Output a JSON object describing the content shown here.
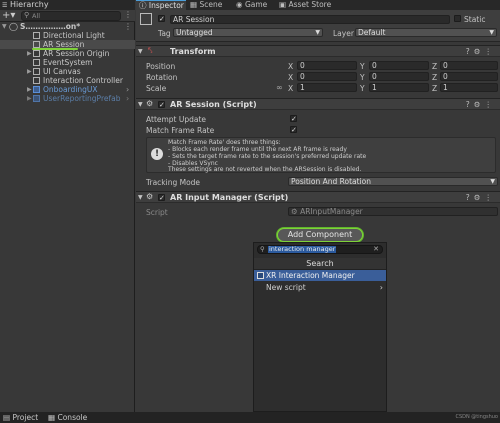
{
  "hierarchy": {
    "tab_label": "Hierarchy",
    "search_placeholder": "All",
    "scene_name": "S…….………on*",
    "items": [
      {
        "label": "Directional Light"
      },
      {
        "label": "AR Session"
      },
      {
        "label": "AR Session Origin"
      },
      {
        "label": "EventSystem"
      },
      {
        "label": "UI Canvas"
      },
      {
        "label": "Interaction Controller"
      },
      {
        "label": "OnboardingUX"
      },
      {
        "label": "UserReportingPrefab"
      }
    ]
  },
  "inspector": {
    "tabs": [
      {
        "label": "Inspector"
      },
      {
        "label": "Scene"
      },
      {
        "label": "Game"
      },
      {
        "label": "Asset Store"
      }
    ],
    "object_name": "AR Session",
    "static_label": "Static",
    "tag_label": "Tag",
    "tag_value": "Untagged",
    "layer_label": "Layer",
    "layer_value": "Default",
    "transform": {
      "title": "Transform",
      "position_label": "Position",
      "rotation_label": "Rotation",
      "scale_label": "Scale",
      "position": {
        "x": "0",
        "y": "0",
        "z": "0"
      },
      "rotation": {
        "x": "0",
        "y": "0",
        "z": "0"
      },
      "scale": {
        "x": "1",
        "y": "1",
        "z": "1"
      }
    },
    "ar_session": {
      "title": "AR Session (Script)",
      "attempt_update_label": "Attempt Update",
      "match_frame_rate_label": "Match Frame Rate",
      "help_lines": [
        "Match Frame Rate' does three things:",
        "- Blocks each render frame until the next AR frame is ready",
        "- Sets the target frame rate to the session's preferred update rate",
        "- Disables VSync",
        "These settings are not reverted when the ARSession is disabled."
      ],
      "tracking_mode_label": "Tracking Mode",
      "tracking_mode_value": "Position And Rotation"
    },
    "ar_input_manager": {
      "title": "AR Input Manager (Script)",
      "script_label": "Script",
      "script_value": "ARInputManager"
    },
    "add_component_label": "Add Component",
    "popup": {
      "search_value": "interaction manager",
      "title": "Search",
      "result": "XR Interaction Manager",
      "new_script": "New script"
    }
  },
  "bottom_tabs": [
    {
      "label": "Project"
    },
    {
      "label": "Console"
    }
  ],
  "watermark": "CSDN @tingshuo",
  "colors": {
    "background": "#383838",
    "selection": "#3a5e99",
    "highlight_ring": "#7fd23a",
    "prefab_blue": "#6a9bd6"
  }
}
